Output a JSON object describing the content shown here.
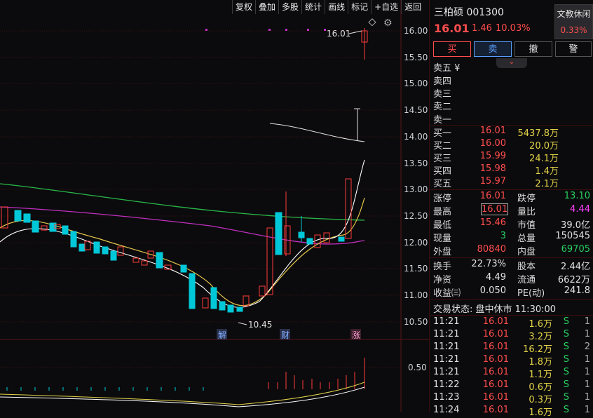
{
  "toolbar": [
    "复权",
    "叠加",
    "多股",
    "统计",
    "画线",
    "标记",
    "+自选",
    "返回"
  ],
  "yaxis": [
    "16.00",
    "15.50",
    "15.00",
    "14.50",
    "14.00",
    "13.50",
    "13.00",
    "12.50",
    "12.00",
    "11.50",
    "11.00",
    "10.50",
    "0.50"
  ],
  "annotations": {
    "high": "16.01",
    "low": "10.45",
    "mark1": "解",
    "mark2": "财",
    "mark3": "涨"
  },
  "stock": {
    "name": "三柏硕 001300",
    "status": "文教休闲",
    "status_pct": "0.33%",
    "price": "16.01",
    "change": "1.46",
    "pct": "10.03%"
  },
  "buttons": {
    "buy": "买",
    "sell": "卖",
    "cancel": "撤",
    "alert": "警"
  },
  "sell_labels": [
    "卖五 ¥",
    "卖四",
    "卖三",
    "卖二",
    "卖一"
  ],
  "bids": [
    {
      "label": "买一",
      "price": "16.01",
      "vol": "5437.8万"
    },
    {
      "label": "买二",
      "price": "16.00",
      "vol": "20.0万"
    },
    {
      "label": "买三",
      "price": "15.99",
      "vol": "24.1万"
    },
    {
      "label": "买四",
      "price": "15.98",
      "vol": "1.4万"
    },
    {
      "label": "买五",
      "price": "15.97",
      "vol": "2.1万"
    }
  ],
  "stats1": [
    {
      "l1": "涨停",
      "v1": "16.01",
      "l2": "跌停",
      "v2": "13.10"
    },
    {
      "l1": "最高",
      "v1": "16.01",
      "l2": "量比",
      "v2": "4.44"
    },
    {
      "l1": "最低",
      "v1": "15.46",
      "l2": "市值",
      "v2": "39.0亿"
    },
    {
      "l1": "现量",
      "v1": "3",
      "l2": "总量",
      "v2": "150545"
    },
    {
      "l1": "外盘",
      "v1": "80840",
      "l2": "内盘",
      "v2": "69705"
    }
  ],
  "stats2": [
    {
      "l1": "换手",
      "v1": "22.73%",
      "l2": "股本",
      "v2": "2.44亿"
    },
    {
      "l1": "净资",
      "v1": "4.49",
      "l2": "流通",
      "v2": "6622万"
    },
    {
      "l1": "收益㈢",
      "v1": "0.050",
      "l2": "PE(动)",
      "v2": "241.8"
    }
  ],
  "trade_status": "交易状态: 盘中休市 11:30:00",
  "ticks": [
    {
      "t": "11:21",
      "p": "16.01",
      "v": "1.6万",
      "s": "S",
      "n": "1"
    },
    {
      "t": "11:21",
      "p": "16.01",
      "v": "3.2万",
      "s": "S",
      "n": "1"
    },
    {
      "t": "11:21",
      "p": "16.01",
      "v": "16.2万",
      "s": "S",
      "n": "2"
    },
    {
      "t": "11:21",
      "p": "16.01",
      "v": "1.8万",
      "s": "S",
      "n": "1"
    },
    {
      "t": "11:21",
      "p": "16.01",
      "v": "1.1万",
      "s": "S",
      "n": "1"
    },
    {
      "t": "11:22",
      "p": "16.01",
      "v": "0.6万",
      "s": "S",
      "n": "1"
    },
    {
      "t": "11:23",
      "p": "16.01",
      "v": "0.3万",
      "s": "S",
      "n": "1"
    },
    {
      "t": "11:24",
      "p": "16.01",
      "v": "1.6万",
      "s": "S",
      "n": "1"
    }
  ]
}
